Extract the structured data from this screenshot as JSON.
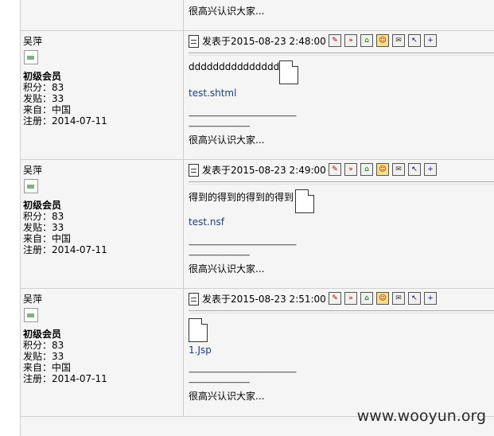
{
  "top_fragment": {
    "signature": "很高兴认识大家..."
  },
  "posts": [
    {
      "username": "吴萍",
      "rank": "初级会员",
      "points": "积分：83",
      "posts_count": "发贴：33",
      "from": "来自：中国",
      "registered": "注册：2014-07-11",
      "posted_at": "发表于2015-08-23 2:48:00",
      "content": "ddddddddddddddddd",
      "attachment": "test.shtml",
      "dash1": "------------------------------------------------------------",
      "dash2": "----------------------------------",
      "signature": "很高兴认识大家..."
    },
    {
      "username": "吴萍",
      "rank": "初级会员",
      "points": "积分：83",
      "posts_count": "发贴：33",
      "from": "来自：中国",
      "registered": "注册：2014-07-11",
      "posted_at": "发表于2015-08-23 2:49:00",
      "content": "得到的得到的得到的得到",
      "attachment": "test.nsf",
      "dash1": "------------------------------------------------------------",
      "dash2": "----------------------------------",
      "signature": "很高兴认识大家..."
    },
    {
      "username": "吴萍",
      "rank": "初级会员",
      "points": "积分：83",
      "posts_count": "发贴：33",
      "from": "来自：中国",
      "registered": "注册：2014-07-11",
      "posted_at": "发表于2015-08-23 2:51:00",
      "content": "",
      "attachment": "1.Jsp",
      "dash1": "------------------------------------------------------------",
      "dash2": "----------------------------------",
      "signature": "很高兴认识大家..."
    }
  ],
  "tools": [
    "ip-icon",
    "quote-icon",
    "home-icon",
    "profile-icon",
    "pm-icon",
    "edit-icon",
    "reply-icon"
  ],
  "watermark": "www.wooyun.org"
}
